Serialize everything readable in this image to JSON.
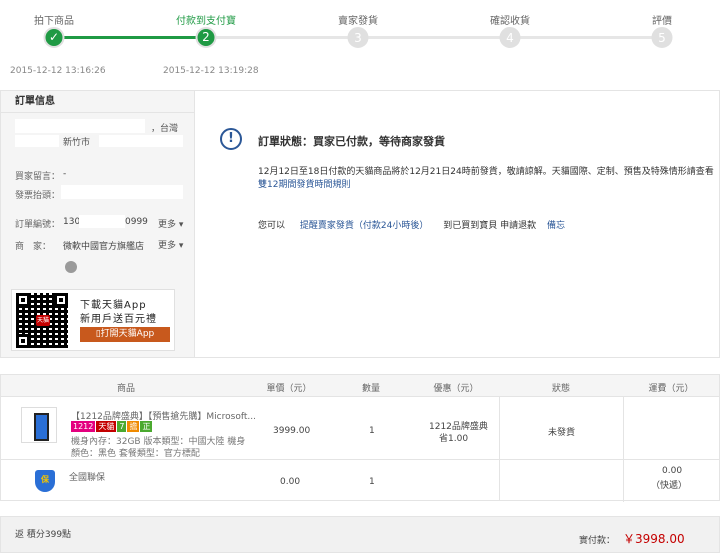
{
  "steps": [
    {
      "label": "拍下商品",
      "num": "✓",
      "time": "2015-12-12 13:16:26"
    },
    {
      "label": "付款到支付寶",
      "num": "2",
      "time": "2015-12-12 13:19:28"
    },
    {
      "label": "賣家發貨",
      "num": "3"
    },
    {
      "label": "確認收貨",
      "num": "4"
    },
    {
      "label": "評價",
      "num": "5"
    }
  ],
  "order_info": {
    "title": "訂單信息",
    "region": "，台灣",
    "city": "新竹市",
    "message_label": "買家留言：",
    "message_value": "-",
    "invoice_label": "發票抬頭：",
    "order_no_label": "訂單編號：",
    "order_no_a": "130",
    "order_no_b": "0999",
    "more_1": "更多",
    "seller_label": "商　家：",
    "seller_value": "微軟中國官方旗艦店",
    "more_2": "更多",
    "app_title": "下載天貓App",
    "app_sub": "新用戶送百元禮",
    "app_button": "打開天貓App",
    "qr_badge": "天貓"
  },
  "status": {
    "icon": "!",
    "title": "訂單狀態：買家已付款，等待商家發貨",
    "desc_text": "12月12日至18日付款的天貓商品將於12月21日24時前發貨，敬請諒解。天貓國際、定制、預售及特殊情形請查看",
    "desc_link": "雙12期間發貨時間規則",
    "actions_prefix": "您可以",
    "remind_link": "提醒賣家發貨（付款24小時後）",
    "refund_prefix": "到已買到寶貝 申請退款",
    "memo_link": "備忘"
  },
  "table": {
    "headers": [
      "商品",
      "單價（元）",
      "數量",
      "優惠（元）",
      "狀態",
      "運費（元）"
    ],
    "item": {
      "title": "【1212品牌盛典】【預售搶先購】Microsoft...",
      "badges": [
        {
          "text": "1212",
          "color": "#e4007f"
        },
        {
          "text": "天貓",
          "color": "#c40000"
        },
        {
          "text": "7",
          "color": "#4aa92f"
        },
        {
          "text": "擔",
          "color": "#f08a00"
        },
        {
          "text": "正",
          "color": "#4aa92f"
        }
      ],
      "spec1": "機身內存：32GB 版本類型：中國大陸 機身",
      "spec2": "顏色：黑色 套餐類型：官方標配",
      "price": "3999.00",
      "qty": "1",
      "discount1": "1212品牌盛典",
      "discount2": "省1.00",
      "status": "未發貨",
      "shipping": "0.00",
      "shipping_note": "（快遞）"
    },
    "insurance": {
      "icon_text": "保",
      "title": "全國聯保",
      "price": "0.00",
      "qty": "1"
    }
  },
  "footer": {
    "points": "返 積分399點",
    "paid_label": "實付款：",
    "paid_value": "￥3998.00"
  }
}
